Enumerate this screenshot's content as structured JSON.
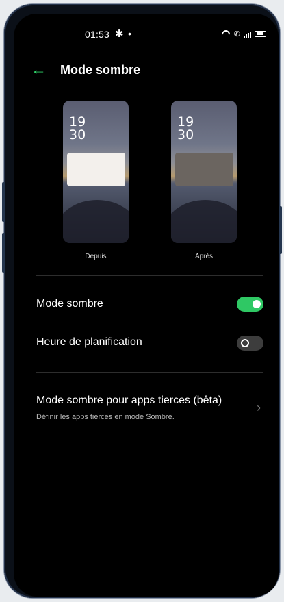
{
  "status_bar": {
    "time": "01:53",
    "icons": [
      "gear-icon",
      "dot-icon",
      "wifi-icon",
      "call-icon",
      "signal-icon",
      "battery-icon"
    ]
  },
  "header": {
    "title": "Mode sombre",
    "back_icon": "arrow-left-icon"
  },
  "previews": [
    {
      "label": "Depuis",
      "clock_hour": "19",
      "clock_minute": "30"
    },
    {
      "label": "Après",
      "clock_hour": "19",
      "clock_minute": "30"
    }
  ],
  "settings": {
    "dark_mode": {
      "label": "Mode sombre",
      "enabled": true
    },
    "schedule": {
      "label": "Heure de planification",
      "enabled": false
    },
    "third_party": {
      "title": "Mode sombre pour apps tierces (bêta)",
      "subtitle": "Définir les apps tierces en mode Sombre."
    }
  },
  "colors": {
    "accent": "#2fc864",
    "background": "#000000",
    "frame": "#0b1018"
  }
}
